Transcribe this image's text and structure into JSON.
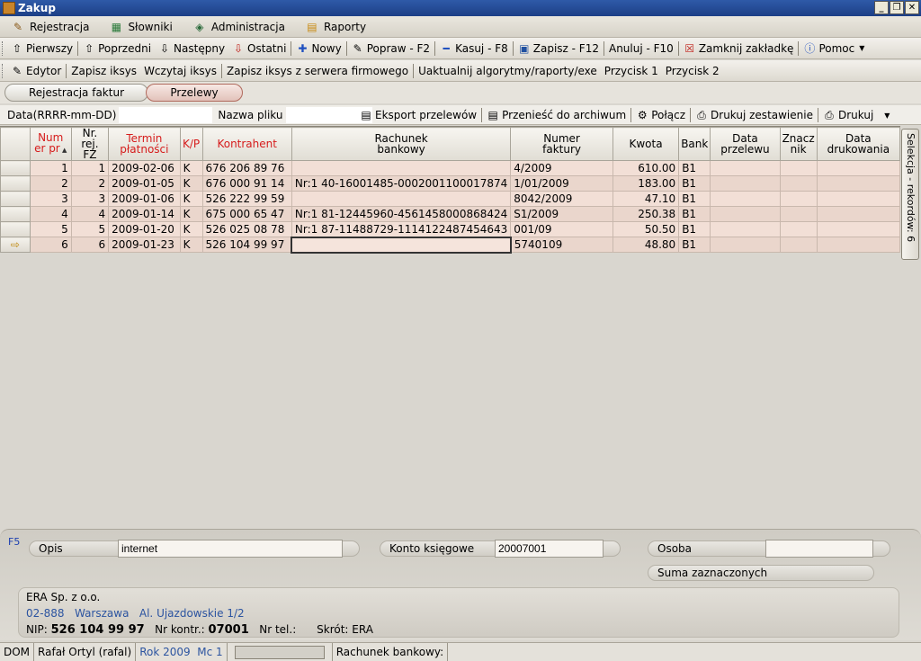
{
  "window": {
    "title": "Zakup"
  },
  "menu": [
    {
      "label": "Rejestracja",
      "icon": "registration-icon"
    },
    {
      "label": "Słowniki",
      "icon": "dictionary-icon"
    },
    {
      "label": "Administracja",
      "icon": "admin-icon"
    },
    {
      "label": "Raporty",
      "icon": "reports-icon"
    }
  ],
  "toolbar1": {
    "first": "Pierwszy",
    "prev": "Poprzedni",
    "next": "Następny",
    "last": "Ostatni",
    "new": "Nowy",
    "edit": "Popraw - F2",
    "delete": "Kasuj - F8",
    "save": "Zapisz - F12",
    "cancel": "Anuluj - F10",
    "close_tab": "Zamknij zakładkę",
    "help": "Pomoc"
  },
  "toolbar2": {
    "editor": "Edytor",
    "save_xsys": "Zapisz iksys",
    "load_xsys": "Wczytaj iksys",
    "save_xsys_server": "Zapisz iksys z serwera firmowego",
    "update": "Uaktualnij algorytmy/raporty/exe",
    "button1": "Przycisk 1",
    "button2": "Przycisk 2"
  },
  "tabs": {
    "invoices": "Rejestracja faktur",
    "transfers": "Przelewy"
  },
  "filter": {
    "date_label": "Data(RRRR-mm-DD)",
    "file_label": "Nazwa pliku",
    "export": "Eksport przelewów",
    "archive": "Przenieść do archiwum",
    "connect": "Połącz",
    "print_summary": "Drukuj zestawienie",
    "print": "Drukuj"
  },
  "grid": {
    "headers": {
      "num": "Num\ner pr",
      "reg": "Nr. rej.\nFZ",
      "due": "Termin\npłatności",
      "kp": "K/P",
      "contractor": "Kontrahent",
      "account": "Rachunek\nbankowy",
      "invoice": "Numer\nfaktury",
      "amount": "Kwota",
      "bank": "Bank",
      "transfer_date": "Data\nprzelewu",
      "mark": "Znacz\nnik",
      "print_date": "Data\ndrukowania"
    },
    "rows": [
      {
        "num": "1",
        "reg": "1",
        "due": "2009-02-06",
        "kp": "K",
        "contractor": "676 206 89 76",
        "account": "",
        "invoice": "4/2009",
        "amount": "610.00",
        "bank": "B1",
        "transfer_date": "",
        "mark": "",
        "print_date": ""
      },
      {
        "num": "2",
        "reg": "2",
        "due": "2009-01-05",
        "kp": "K",
        "contractor": "676 000 91 14",
        "account": "Nr:1 40-16001485-0002001100017874",
        "invoice": "1/01/2009",
        "amount": "183.00",
        "bank": "B1",
        "transfer_date": "",
        "mark": "",
        "print_date": ""
      },
      {
        "num": "3",
        "reg": "3",
        "due": "2009-01-06",
        "kp": "K",
        "contractor": "526 222 99 59",
        "account": "",
        "invoice": "8042/2009",
        "amount": "47.10",
        "bank": "B1",
        "transfer_date": "",
        "mark": "",
        "print_date": ""
      },
      {
        "num": "4",
        "reg": "4",
        "due": "2009-01-14",
        "kp": "K",
        "contractor": "675 000 65 47",
        "account": "Nr:1 81-12445960-4561458000868424",
        "invoice": "S1/2009",
        "amount": "250.38",
        "bank": "B1",
        "transfer_date": "",
        "mark": "",
        "print_date": ""
      },
      {
        "num": "5",
        "reg": "5",
        "due": "2009-01-20",
        "kp": "K",
        "contractor": "526 025 08 78",
        "account": "Nr:1 87-11488729-1114122487454643",
        "invoice": "001/09",
        "amount": "50.50",
        "bank": "B1",
        "transfer_date": "",
        "mark": "",
        "print_date": ""
      },
      {
        "num": "6",
        "reg": "6",
        "due": "2009-01-23",
        "kp": "K",
        "contractor": "526 104 99 97",
        "account": "",
        "invoice": "5740109",
        "amount": "48.80",
        "bank": "B1",
        "transfer_date": "",
        "mark": "",
        "print_date": ""
      }
    ],
    "current_row": 5
  },
  "sidetab": "Selekcja - rekordów: 6",
  "details": {
    "f5": "F5",
    "desc_label": "Opis",
    "desc_value": "internet",
    "account_label": "Konto księgowe",
    "account_value": "20007001",
    "person_label": "Osoba",
    "person_value": "",
    "sum_label": "Suma zaznaczonych",
    "contractor": {
      "name": "ERA Sp. z o.o.",
      "postal": "02-888",
      "city": "Warszawa",
      "street": "Al. Ujazdowskie 1/2",
      "nip_label": "NIP:",
      "nip": "526 104 99 97",
      "contract_label": "Nr kontr.:",
      "contract": "07001",
      "tel_label": "Nr tel.:",
      "short_label": "Skrót:",
      "short": "ERA"
    }
  },
  "status": {
    "db": "DOM",
    "user": "Rafał Ortyl (rafal)",
    "year": "Rok 2009",
    "month": "Mc 1",
    "account_label": "Rachunek bankowy:"
  },
  "colors": {
    "title_bar": "#1c3f86",
    "red_header": "#d61c1c",
    "row_bg": "#f2dfd6",
    "link_blue": "#2c54a0"
  }
}
